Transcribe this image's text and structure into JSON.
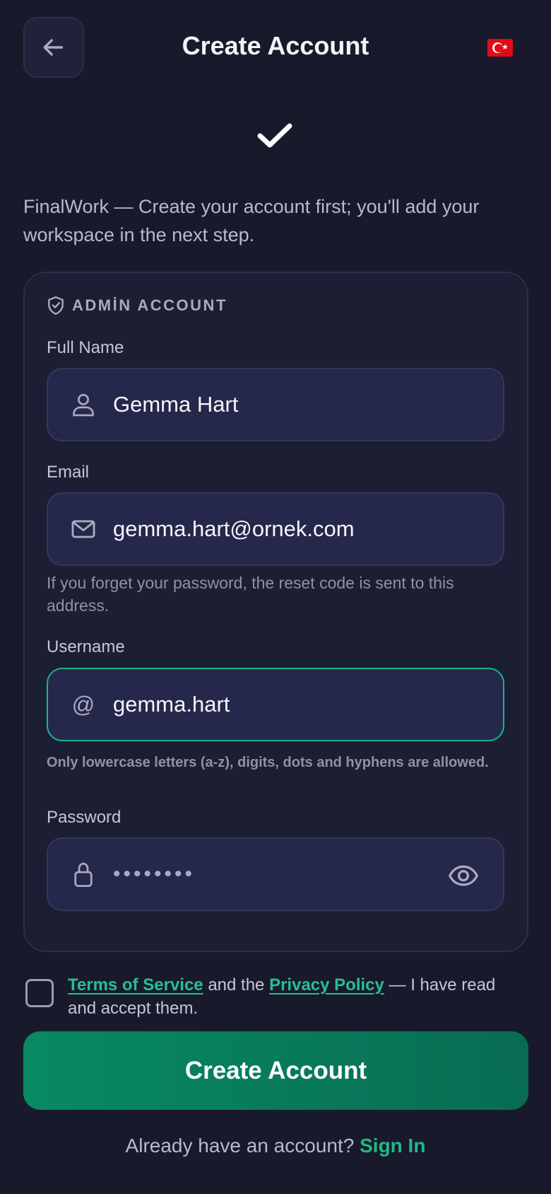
{
  "header": {
    "title": "Create Account",
    "language_flag": "turkey-flag"
  },
  "intro_text": "FinalWork — Create your account first; you'll add your workspace in the next step.",
  "card": {
    "section_title": "ADMİN ACCOUNT",
    "full_name": {
      "label": "Full Name",
      "value": "Gemma Hart",
      "icon": "user-icon"
    },
    "email": {
      "label": "Email",
      "value": "gemma.hart@ornek.com",
      "icon": "mail-icon",
      "hint": "If you forget your password, the reset code is sent to this address."
    },
    "username": {
      "label": "Username",
      "at_symbol": "@",
      "value": "gemma.hart",
      "hint": "Only lowercase letters (a-z), digits, dots and hyphens are allowed."
    },
    "password": {
      "label": "Password",
      "masked_value": "••••••••",
      "icon": "lock-icon"
    }
  },
  "terms": {
    "terms_link": "Terms of Service",
    "connector": " and the ",
    "privacy_link": "Privacy Policy",
    "suffix": " — I have read and accept them."
  },
  "submit_label": "Create Account",
  "signin": {
    "prompt": "Already have an account? ",
    "link": "Sign In"
  },
  "colors": {
    "background": "#181a2c",
    "accent": "#1db48a",
    "button": "#078a63"
  }
}
